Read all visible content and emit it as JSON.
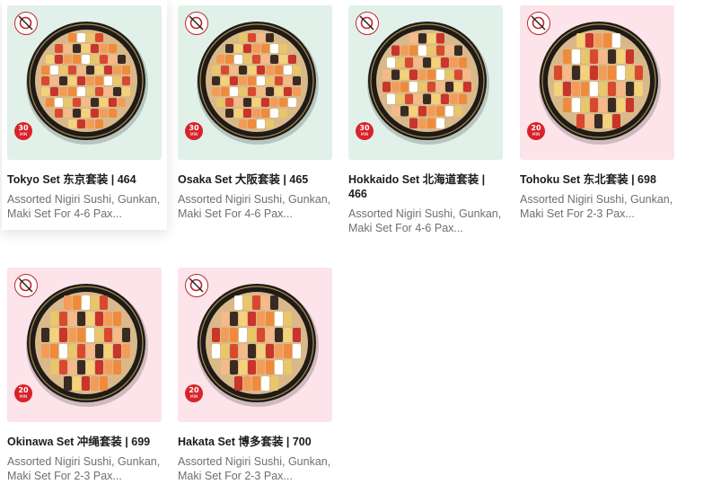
{
  "products": [
    {
      "title": "Tokyo Set 东京套装 | 464",
      "description": "Assorted Nigiri Sushi, Gunkan, Maki Set For 4-6 Pax...",
      "badge_number": "30",
      "badge_unit": "MIN",
      "background": "#e1f1ea",
      "hovered": true
    },
    {
      "title": "Osaka Set 大阪套装 | 465",
      "description": "Assorted Nigiri Sushi, Gunkan, Maki Set For 4-6 Pax...",
      "badge_number": "30",
      "badge_unit": "MIN",
      "background": "#e1f1ea",
      "hovered": false
    },
    {
      "title": "Hokkaido Set 北海道套装 | 466",
      "description": "Assorted Nigiri Sushi, Gunkan, Maki Set For 4-6 Pax...",
      "badge_number": "30",
      "badge_unit": "MIN",
      "background": "#e1f1ea",
      "hovered": false
    },
    {
      "title": "Tohoku Set 东北套装 | 698",
      "description": "Assorted Nigiri Sushi, Gunkan, Maki Set For 2-3 Pax...",
      "badge_number": "20",
      "badge_unit": "MIN",
      "background": "#fde3ea",
      "hovered": false
    },
    {
      "title": "Okinawa Set 冲绳套装 | 699",
      "description": "Assorted Nigiri Sushi, Gunkan, Maki Set For 2-3 Pax...",
      "badge_number": "20",
      "badge_unit": "MIN",
      "background": "#fde3ea",
      "hovered": false
    },
    {
      "title": "Hakata Set 博多套装 | 700",
      "description": "Assorted Nigiri Sushi, Gunkan, Maki Set For 2-3 Pax...",
      "badge_number": "20",
      "badge_unit": "MIN",
      "background": "#fde3ea",
      "hovered": false
    }
  ],
  "brand": {
    "accent": "#d8232a"
  }
}
